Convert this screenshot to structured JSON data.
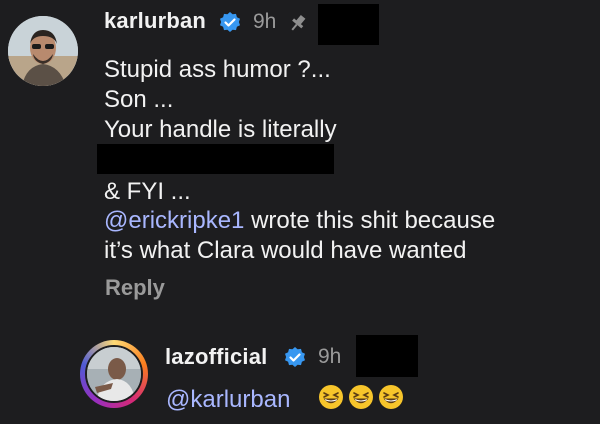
{
  "comment": {
    "username": "karlurban",
    "time": "9h",
    "lines": [
      "Stupid ass humor ?...",
      "Son ...",
      "Your handle is literally",
      "& FYI ..."
    ],
    "mention": "@erickripke1",
    "mention_rest": " wrote this shit because",
    "last_line": "it’s what Clara would have wanted",
    "reply_label": "Reply"
  },
  "reply": {
    "username": "lazofficial",
    "time": "9h",
    "mention": "@karlurban",
    "emojis": [
      "grinning-squinting-face",
      "grinning-squinting-face",
      "grinning-squinting-face"
    ]
  },
  "colors": {
    "background": "#1d1d1f",
    "mention": "#a9b7ff",
    "verified": "#3797f0",
    "muted": "#9a9a9a"
  }
}
